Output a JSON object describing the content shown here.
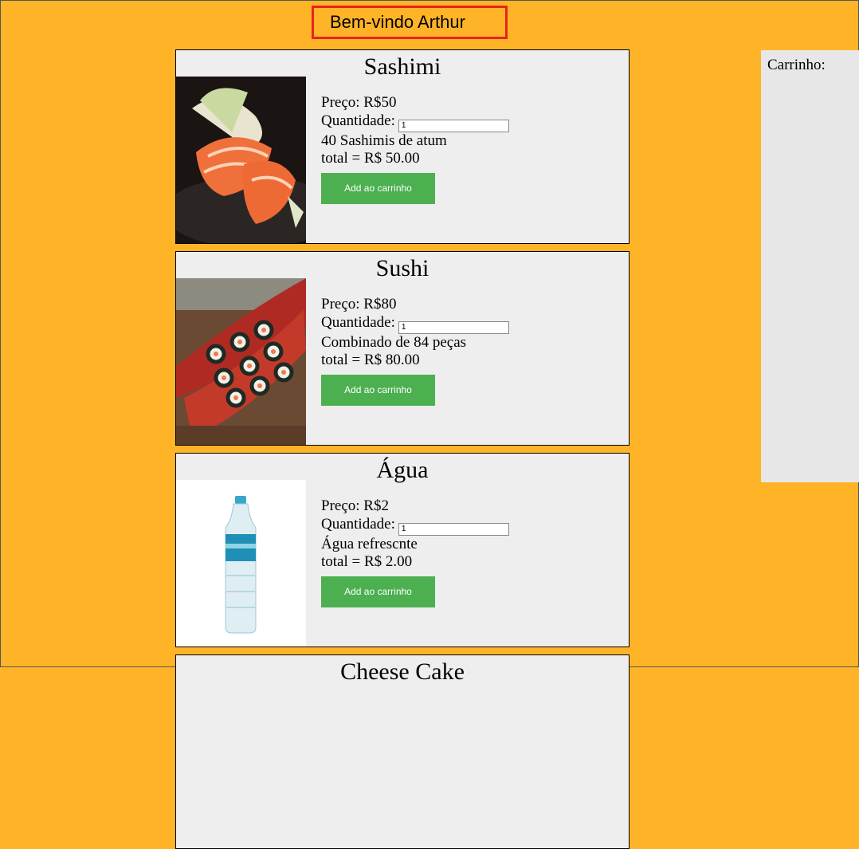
{
  "header": {
    "greeting": "Bem-vindo Arthur"
  },
  "products": [
    {
      "title": "Sashimi",
      "price": "Preço: R$50",
      "quantity_label": "Quantidade:",
      "quantity_value": "1",
      "description": "40 Sashimis de atum",
      "total": "total = R$ 50.00",
      "button": "Add ao carrinho"
    },
    {
      "title": "Sushi",
      "price": "Preço: R$80",
      "quantity_label": "Quantidade:",
      "quantity_value": "1",
      "description": "Combinado de 84 peças",
      "total": "total = R$ 80.00",
      "button": "Add ao carrinho"
    },
    {
      "title": "Água",
      "price": "Preço: R$2",
      "quantity_label": "Quantidade:",
      "quantity_value": "1",
      "description": "Água refrescnte",
      "total": "total = R$ 2.00",
      "button": "Add ao carrinho"
    },
    {
      "title": "Cheese Cake"
    }
  ],
  "cart": {
    "label": "Carrinho:"
  },
  "colors": {
    "background": "#FFB428",
    "card": "#EEEEEE",
    "button": "#4CAF50",
    "greeting_border": "#E8231E",
    "cart": "#E7E7E7"
  }
}
